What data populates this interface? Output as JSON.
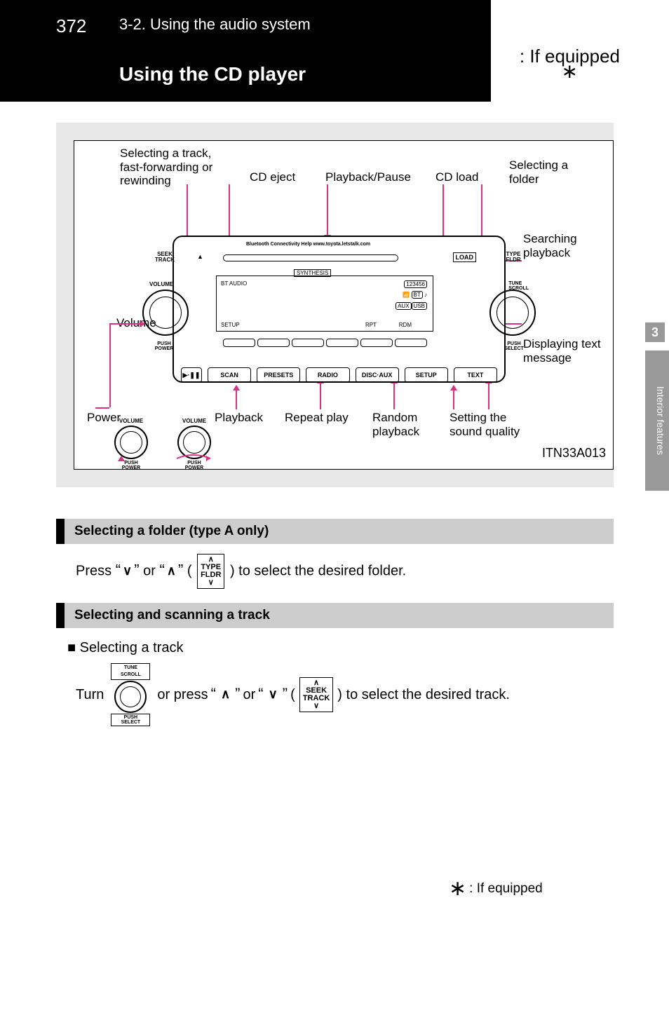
{
  "header": {
    "page_num": "372",
    "breadcrumb": "3-2. Using the audio system",
    "title": "Using the CD player",
    "if_equipped": ": If equipped"
  },
  "figure": {
    "id_label": "ITN33A013",
    "callouts": {
      "top_left_1": "Selecting a track,\nfast-forwarding or\nrewinding",
      "top_left_2": "CD eject",
      "top_mid": "Playback/Pause",
      "top_right_1": "CD load",
      "top_right_2": "Selecting a\nfolder",
      "right_1": "Searching\nplayback",
      "right_2": "Displaying text\nmessage",
      "right_3": "Setting the\nsound quality",
      "bottom_1": "Random\nplayback",
      "bottom_2": "Repeat play",
      "bottom_3": "Playback",
      "left_1": "Power",
      "left_2": "Volume"
    },
    "panel": {
      "seek_track": "SEEK\nTRACK",
      "volume": "VOLUME",
      "load": "LOAD",
      "type_fldr": "TYPE\nFLDR",
      "tune_scroll": "TUNE\nSCROLL",
      "push_power": "PUSH\nPOWER",
      "push_select": "PUSH\nSELECT",
      "bt_audio": "BT AUDIO",
      "setup_lbl": "SETUP",
      "rpt": "RPT",
      "rdm": "RDM",
      "bluetooth_help": "Bluetooth Connectivity Help  www.toyota.letstalk.com",
      "synthesis": "SYNTHESIS",
      "aux": "AUX",
      "usb": "USB",
      "bt": "BT",
      "bottom_buttons": [
        "SCAN",
        "PRESETS",
        "RADIO",
        "DISC·AUX",
        "SETUP",
        "TEXT"
      ],
      "playpause": "▶·❚❚",
      "small_volume": "VOLUME",
      "small_push_power": "PUSH\nPOWER"
    }
  },
  "sections": {
    "folder": {
      "title": "Selecting a folder (type A only)",
      "body_prefix": "Press ",
      "body_mid": " ) to select the desired folder.",
      "or_word": " or ",
      "type_fldr_btn_top": "∧",
      "type_fldr_btn_mid": "TYPE\nFLDR",
      "type_fldr_btn_bot": "∨",
      "open_paren": "(",
      "chev_down": "∨",
      "chev_up": "∧"
    },
    "track": {
      "title": "Selecting and scanning a track",
      "sub": "Selecting a track",
      "step_turn": "Turn ",
      "step_press": " or press ",
      "step_open": "(",
      "step_close": ") to select the desired track.",
      "chev_up": "∧",
      "chev_down": "∨",
      "or_word": " or ",
      "seek_track_top": "∧",
      "seek_track_mid": "SEEK\nTRACK",
      "seek_track_bot": "∨",
      "tune_top": "TUNE\nSCROLL",
      "tune_bot": "PUSH\nSELECT"
    }
  },
  "side": {
    "num": "3",
    "label": "Interior features"
  },
  "footnote": ": If equipped"
}
